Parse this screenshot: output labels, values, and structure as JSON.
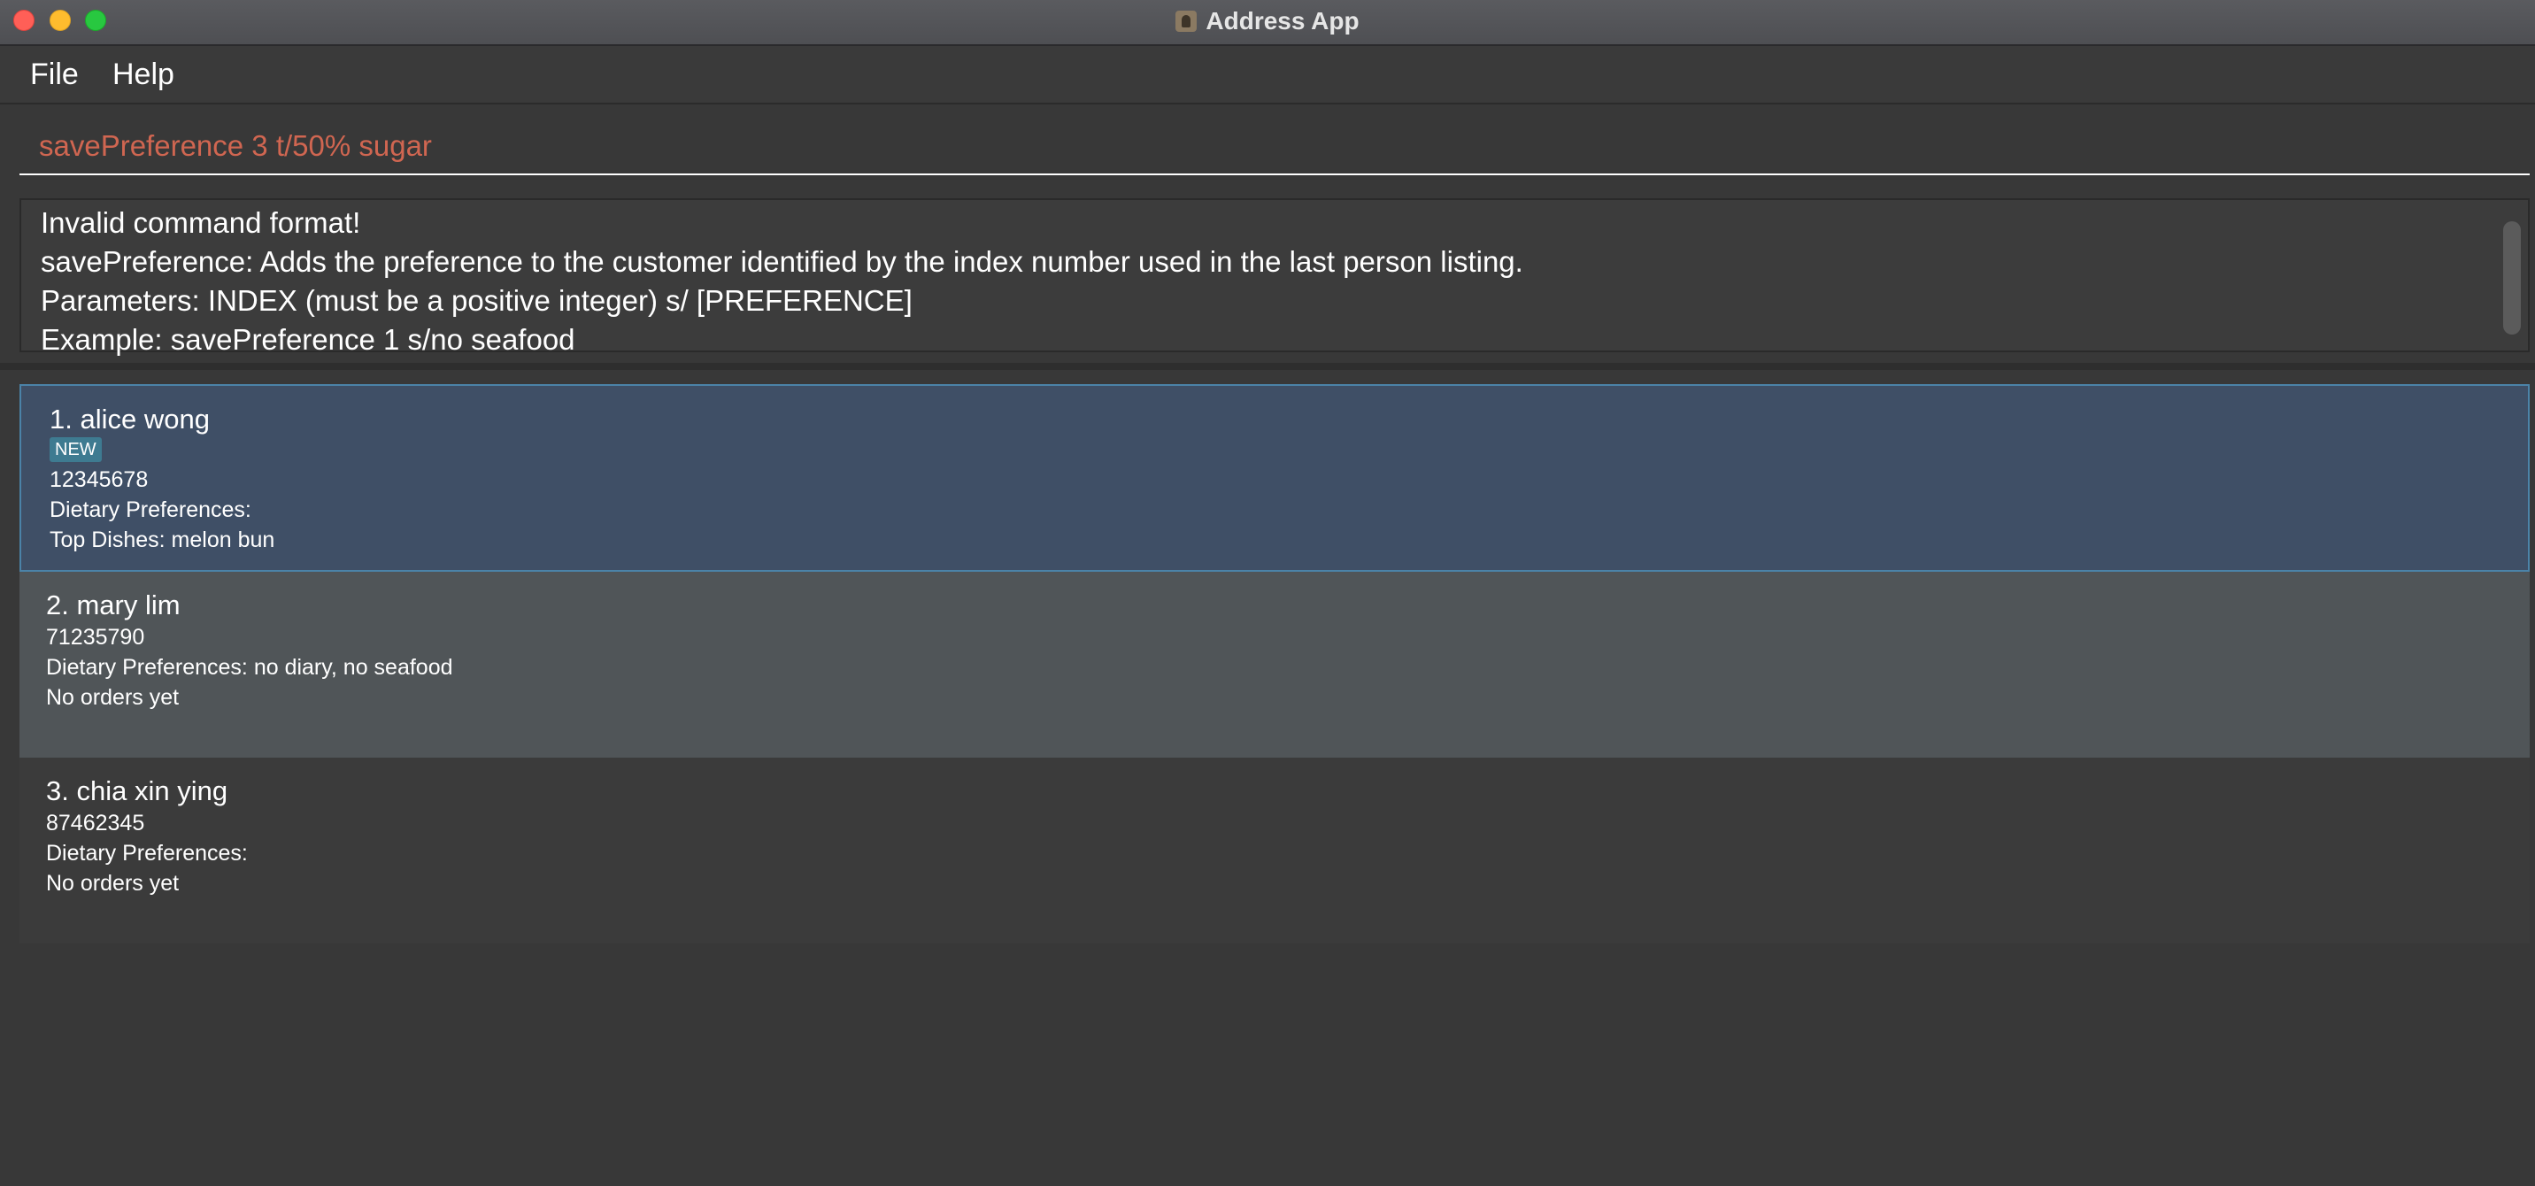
{
  "window": {
    "title": "Address App"
  },
  "menu": {
    "file": "File",
    "help": "Help"
  },
  "command": {
    "value": "savePreference 3 t/50% sugar",
    "text_color": "#d06651"
  },
  "result": {
    "lines": [
      "Invalid command format!",
      "savePreference: Adds the preference to the customer identified by the index number used in the last person listing.",
      "Parameters: INDEX (must be a positive integer) s/ [PREFERENCE]",
      "Example: savePreference 1 s/no seafood"
    ]
  },
  "persons": [
    {
      "name": "1. alice wong",
      "tag": "NEW",
      "phone": "12345678",
      "dietary": "Dietary Preferences:",
      "orders": "Top Dishes: melon bun"
    },
    {
      "name": "2. mary lim",
      "phone": "71235790",
      "dietary": "Dietary Preferences: no diary, no seafood",
      "orders": "No orders yet"
    },
    {
      "name": "3. chia xin ying",
      "phone": "87462345",
      "dietary": "Dietary Preferences:",
      "orders": "No orders yet"
    }
  ],
  "colors": {
    "background": "#383838",
    "selected_card": "#3f4f66",
    "selected_border": "#4b83a8",
    "even_card": "#505558",
    "tag": "#3e7b91"
  }
}
